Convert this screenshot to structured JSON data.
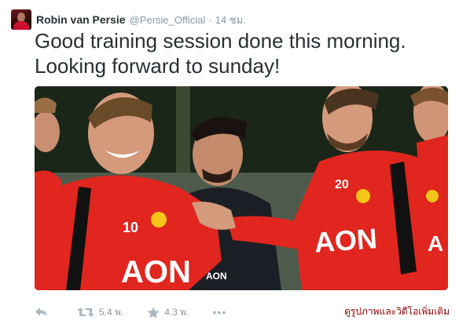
{
  "tweet": {
    "fullname": "Robin van Persie",
    "username": "@Persie_Official",
    "separator": "·",
    "time": "14 ชม.",
    "text_line1": "Good training session done this morning.",
    "text_line2": "Looking forward to sunday!"
  },
  "photo": {
    "shirt_text": "AON",
    "number_left": "10",
    "number_right": "20"
  },
  "actions": {
    "retweet_count": "5.4 พ.",
    "favorite_count": "4.3 พ.",
    "more_label": "•••"
  },
  "more_media_link": "ดูรูปภาพและวิดีโอเพิ่มเติม",
  "colors": {
    "jersey_red": "#e0261f",
    "link_red": "#8b0000",
    "muted": "#8899a6",
    "icon_gray": "#aab8c2"
  }
}
